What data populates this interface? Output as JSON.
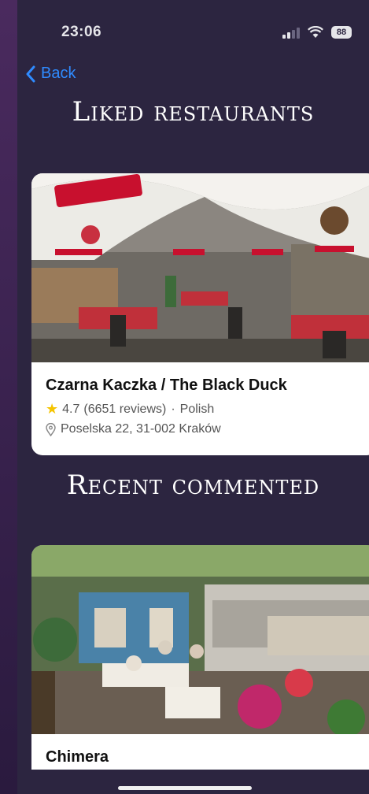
{
  "status": {
    "time": "23:06",
    "battery": "88"
  },
  "nav": {
    "back_label": "Back"
  },
  "sections": {
    "liked_title": "Liked restaurants",
    "recent_title": "Recent commented"
  },
  "liked": [
    {
      "name": "Czarna Kaczka / The Black Duck",
      "rating": "4.7",
      "reviews": "(6651 reviews)",
      "cuisine": "Polish",
      "address": "Poselska 22, 31-002 Kraków"
    }
  ],
  "recent": [
    {
      "name": "Chimera"
    }
  ],
  "colors": {
    "accent": "#2f8bff",
    "star": "#f5c400",
    "background": "#2c2540"
  }
}
